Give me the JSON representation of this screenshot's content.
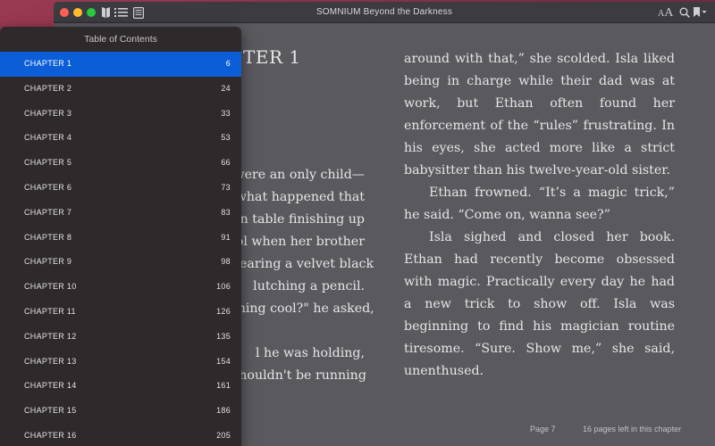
{
  "window": {
    "title": "SOMNIUM Beyond the Darkness",
    "font_size_small": "A",
    "font_size_large": "A"
  },
  "toc": {
    "heading": "Table of Contents",
    "items": [
      {
        "label": "CHAPTER 1",
        "page": "6",
        "selected": true
      },
      {
        "label": "CHAPTER 2",
        "page": "24"
      },
      {
        "label": "CHAPTER 3",
        "page": "33"
      },
      {
        "label": "CHAPTER 4",
        "page": "53"
      },
      {
        "label": "CHAPTER 5",
        "page": "66"
      },
      {
        "label": "CHAPTER 6",
        "page": "73"
      },
      {
        "label": "CHAPTER 7",
        "page": "83"
      },
      {
        "label": "CHAPTER 8",
        "page": "91"
      },
      {
        "label": "CHAPTER 9",
        "page": "98"
      },
      {
        "label": "CHAPTER 10",
        "page": "106"
      },
      {
        "label": "CHAPTER 11",
        "page": "126"
      },
      {
        "label": "CHAPTER 12",
        "page": "135"
      },
      {
        "label": "CHAPTER 13",
        "page": "154"
      },
      {
        "label": "CHAPTER 14",
        "page": "161"
      },
      {
        "label": "CHAPTER 15",
        "page": "186"
      },
      {
        "label": "CHAPTER 16",
        "page": "205"
      }
    ]
  },
  "book": {
    "chapter_heading_visible": "TER 1",
    "left_lines": [
      "were an only child—",
      "what happened that",
      "en table finishing up",
      "ol when her brother",
      "vearing a velvet black",
      "lutching a pencil.",
      "thing cool?\" he asked,",
      "",
      "l he was holding,",
      "shouldn't be running"
    ],
    "right_paragraphs": [
      "around with that,” she scolded. Isla liked being in charge while their dad was at work, but Ethan often found her enforcement of the “rules” frustrating. In his eyes, she acted more like a strict babysitter than his twelve-year-old sister.",
      "Ethan frowned. “It’s a magic trick,” he said. “Come on, wanna see?”",
      "Isla sighed and closed her book. Ethan had recently become obsessed with magic. Practically every day he had a new trick to show off. Isla was beginning to find his magician routine tiresome. “Sure. Show me,” she said, unenthused."
    ]
  },
  "footer": {
    "page": "Page 7",
    "remaining": "16 pages left in this chapter"
  },
  "colors": {
    "selection": "#0b5ed7",
    "page_background": "#5a595e",
    "toc_background": "#2e292a"
  }
}
